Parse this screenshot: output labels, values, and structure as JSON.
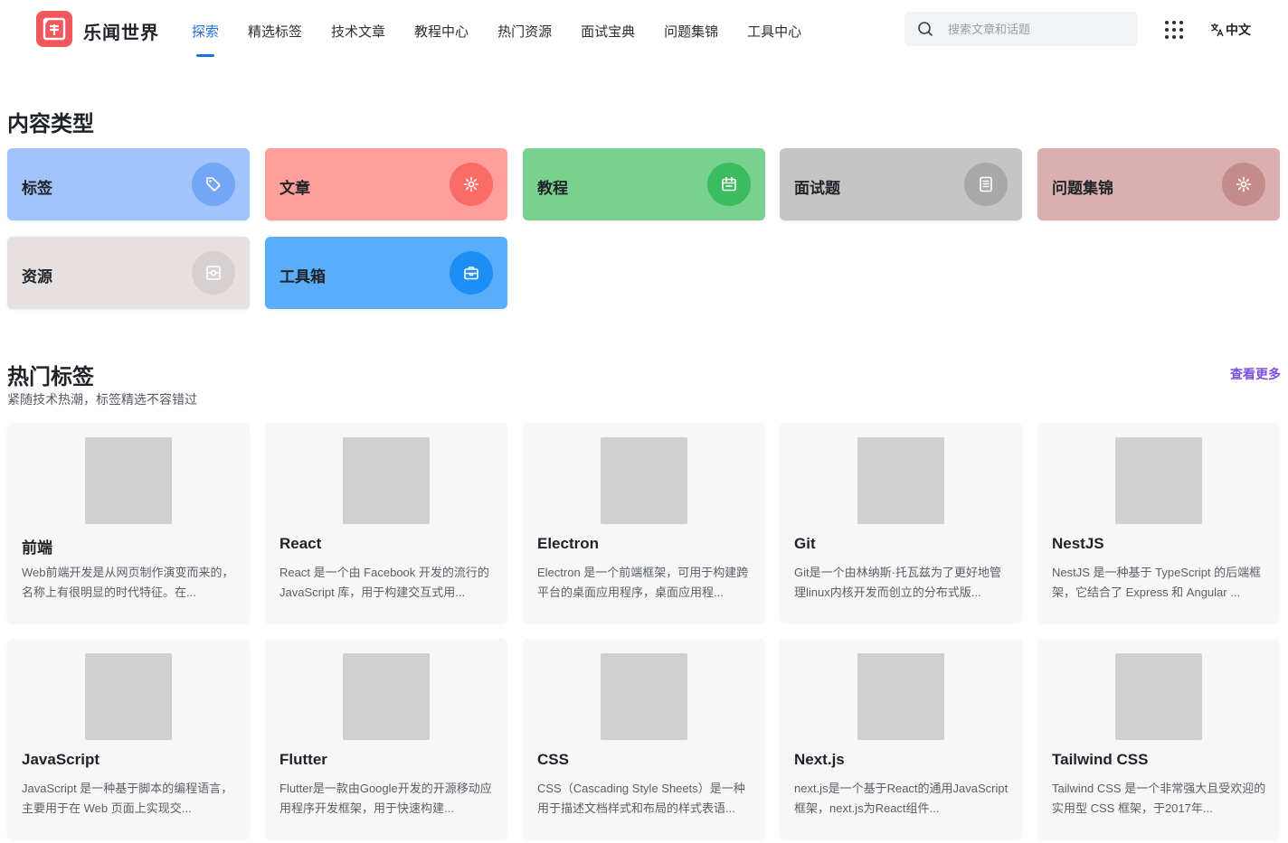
{
  "header": {
    "brand": "乐闻世界",
    "logo_glyph": "闻",
    "nav": [
      {
        "label": "探索",
        "active": true
      },
      {
        "label": "精选标签"
      },
      {
        "label": "技术文章"
      },
      {
        "label": "教程中心"
      },
      {
        "label": "热门资源"
      },
      {
        "label": "面试宝典"
      },
      {
        "label": "问题集锦"
      },
      {
        "label": "工具中心"
      }
    ],
    "search_placeholder": "搜索文章和话题",
    "lang_label": "中文",
    "icons": {
      "search": "search-icon",
      "apps": "apps-grid-icon",
      "lang": "translate-icon"
    }
  },
  "content_types": {
    "title": "内容类型",
    "items": [
      {
        "label": "标签",
        "icon": "tag-icon",
        "bg": "#a0c4f9",
        "circle": "#74a6f5"
      },
      {
        "label": "文章",
        "icon": "gear-icon",
        "bg": "#ff9f9c",
        "circle": "#fb6b68"
      },
      {
        "label": "教程",
        "icon": "calendar-icon",
        "bg": "#79d18f",
        "circle": "#3dbb5f"
      },
      {
        "label": "面试题",
        "icon": "document-icon",
        "bg": "#c5c5c5",
        "circle": "#a8a8a8"
      },
      {
        "label": "问题集锦",
        "icon": "gear-icon",
        "bg": "#d9afaf",
        "circle": "#c58b8b"
      },
      {
        "label": "资源",
        "icon": "resource-icon",
        "bg": "#e6e1e0",
        "circle": "#d6d1d0"
      },
      {
        "label": "工具箱",
        "icon": "toolbox-icon",
        "bg": "#5aaef9",
        "circle": "#1c8ef5"
      }
    ]
  },
  "hot_tags": {
    "title": "热门标签",
    "subtitle": "紧随技术热潮，标签精选不容错过",
    "more_label": "查看更多",
    "items": [
      {
        "name": "前端",
        "desc": "Web前端开发是从网页制作演变而来的，名称上有很明显的时代特征。在..."
      },
      {
        "name": "React",
        "desc": "React 是一个由 Facebook 开发的流行的 JavaScript 库，用于构建交互式用..."
      },
      {
        "name": "Electron",
        "desc": "Electron 是一个前端框架，可用于构建跨平台的桌面应用程序，桌面应用程..."
      },
      {
        "name": "Git",
        "desc": "Git是一个由林纳斯·托瓦兹为了更好地管理linux内核开发而创立的分布式版..."
      },
      {
        "name": "NestJS",
        "desc": "NestJS 是一种基于 TypeScript 的后端框架，它结合了 Express 和 Angular ..."
      },
      {
        "name": "JavaScript",
        "desc": "JavaScript 是一种基于脚本的编程语言，主要用于在 Web 页面上实现交..."
      },
      {
        "name": "Flutter",
        "desc": "Flutter是一款由Google开发的开源移动应用程序开发框架，用于快速构建..."
      },
      {
        "name": "CSS",
        "desc": "CSS（Cascading Style Sheets）是一种用于描述文档样式和布局的样式表语..."
      },
      {
        "name": "Next.js",
        "desc": "next.js是一个基于React的通用JavaScript框架，next.js为React组件..."
      },
      {
        "name": "Tailwind CSS",
        "desc": "Tailwind CSS 是一个非常强大且受欢迎的实用型 CSS 框架，于2017年..."
      }
    ]
  }
}
